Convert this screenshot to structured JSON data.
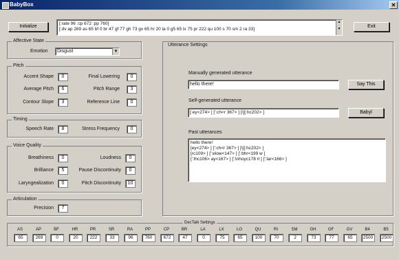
{
  "window": {
    "title": "BabyBox",
    "close": "✕"
  },
  "toolbar": {
    "initialize_label": "Initialize",
    "exit_label": "Exit",
    "status_lines": [
      "[:rate 96 :cp 672 :pp 760]",
      "[:dv  ap 269 as 65 bf 0 br 47 gf 77 gh 73 gv 65 hr 20 la 0 g5 65 lx 75 pr 222 qu 100 s 70 sm 2 ra 33]"
    ]
  },
  "affective": {
    "title": "Affective State",
    "emotion_label": "Emotion",
    "emotion_value": "Disgust"
  },
  "pitch": {
    "title": "Pitch",
    "left": [
      {
        "label": "Accent Shape",
        "value": "0"
      },
      {
        "label": "Average Pitch",
        "value": "6"
      },
      {
        "label": "Contour Slope",
        "value": "3"
      }
    ],
    "right": [
      {
        "label": "Final Lowering",
        "value": "0"
      },
      {
        "label": "Pitch Range",
        "value": "3"
      },
      {
        "label": "Reference Line",
        "value": "0"
      }
    ]
  },
  "timing": {
    "title": "Timing",
    "items": [
      {
        "label": "Speech Rate",
        "value": "8"
      },
      {
        "label": "Stress Frequency",
        "value": "0"
      }
    ]
  },
  "voice": {
    "title": "Voice Quality",
    "left": [
      {
        "label": "Breathiness",
        "value": "0"
      },
      {
        "label": "Brilliance",
        "value": "5"
      },
      {
        "label": "Laryngealization",
        "value": "0"
      }
    ],
    "right": [
      {
        "label": "Loudness",
        "value": "0"
      },
      {
        "label": "Pause Discontinuity",
        "value": "0"
      },
      {
        "label": "Pitch Discontinuity",
        "value": "10"
      }
    ]
  },
  "articulation": {
    "title": "Articulation",
    "label": "Precision",
    "value": "7"
  },
  "utterance": {
    "title": "Utterance Settings",
    "manual_label": "Manually generated utterance",
    "manual_value": "hello there!",
    "say_label": "Say This",
    "self_label": "Self-generated utterance",
    "self_value": "[:ey<274> ] [':ch<r 367> ] [\\][:hc202> ]",
    "babyl_label": "Babyl",
    "past_label": "Past utterances",
    "past_lines": [
      "hello there!",
      "[ey<274> ] [':ch<r 367> ] [\\][:hc202> ]",
      "[rc109> ] [':elow<147> ] [':bhr<199 w ]",
      "[':lhc106> ay<167> ] [':lnhoyc178 rl ] [':lar<166> ]"
    ]
  },
  "dectalk": {
    "title": "DecTalk Settings",
    "params": [
      {
        "label": "AS",
        "value": "65"
      },
      {
        "label": "AP",
        "value": "269"
      },
      {
        "label": "BF",
        "value": "0"
      },
      {
        "label": "HR",
        "value": "20"
      },
      {
        "label": "PR",
        "value": "222"
      },
      {
        "label": "SR",
        "value": "33"
      },
      {
        "label": "RA",
        "value": "96"
      },
      {
        "label": "PP",
        "value": "760"
      },
      {
        "label": "CP",
        "value": "672"
      },
      {
        "label": "BR",
        "value": "47"
      },
      {
        "label": "LA",
        "value": "0"
      },
      {
        "label": "LX",
        "value": "75"
      },
      {
        "label": "LO",
        "value": "65"
      },
      {
        "label": "QU",
        "value": "100"
      },
      {
        "label": "RI",
        "value": "70"
      },
      {
        "label": "SM",
        "value": "2"
      },
      {
        "label": "GH",
        "value": "73"
      },
      {
        "label": "GF",
        "value": "77"
      },
      {
        "label": "GV",
        "value": "65"
      },
      {
        "label": "B4",
        "value": "2500"
      },
      {
        "label": "B5",
        "value": "2500"
      }
    ]
  }
}
